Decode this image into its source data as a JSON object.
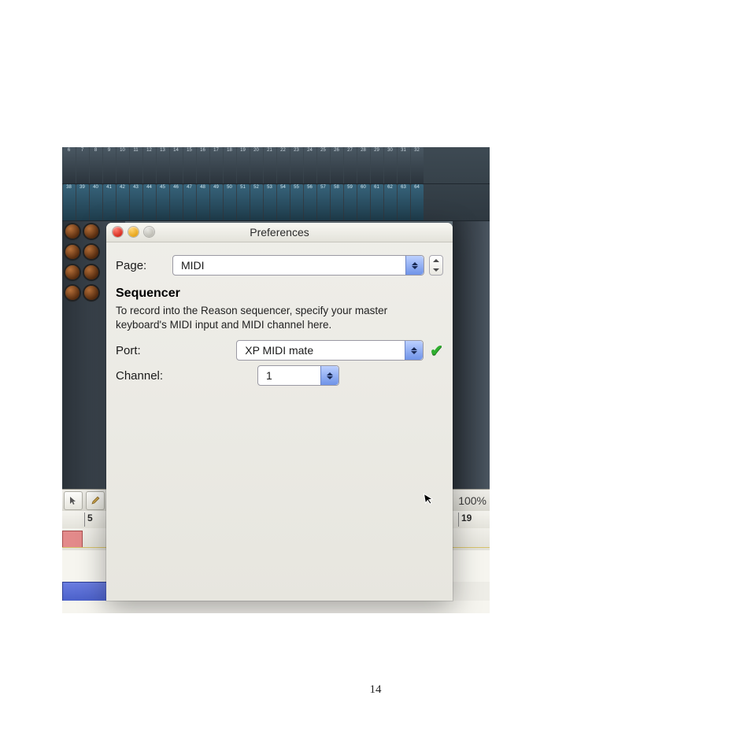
{
  "page_number": "14",
  "background": {
    "mixer_row1": [
      "6",
      "7",
      "8",
      "9",
      "10",
      "11",
      "12",
      "13",
      "14",
      "15",
      "16",
      "17",
      "18",
      "19",
      "20",
      "21",
      "22",
      "23",
      "24",
      "25",
      "26",
      "27",
      "28",
      "29",
      "30",
      "31",
      "32"
    ],
    "mixer_row2": [
      "38",
      "39",
      "40",
      "41",
      "42",
      "43",
      "44",
      "45",
      "46",
      "47",
      "48",
      "49",
      "50",
      "51",
      "52",
      "53",
      "54",
      "55",
      "56",
      "57",
      "58",
      "59",
      "60",
      "61",
      "62",
      "63",
      "64"
    ],
    "toolbar_zoom": "100%",
    "ruler_marks": [
      {
        "pos": 28,
        "label": "5"
      },
      {
        "pos": 503,
        "label": "19"
      }
    ]
  },
  "dialog": {
    "title": "Preferences",
    "page_label": "Page:",
    "page_value": "MIDI",
    "section_heading": "Sequencer",
    "description": "To record into the Reason sequencer, specify your master keyboard's MIDI input and MIDI channel here.",
    "port_label": "Port:",
    "port_value": "XP MIDI mate",
    "channel_label": "Channel:",
    "channel_value": "1"
  }
}
